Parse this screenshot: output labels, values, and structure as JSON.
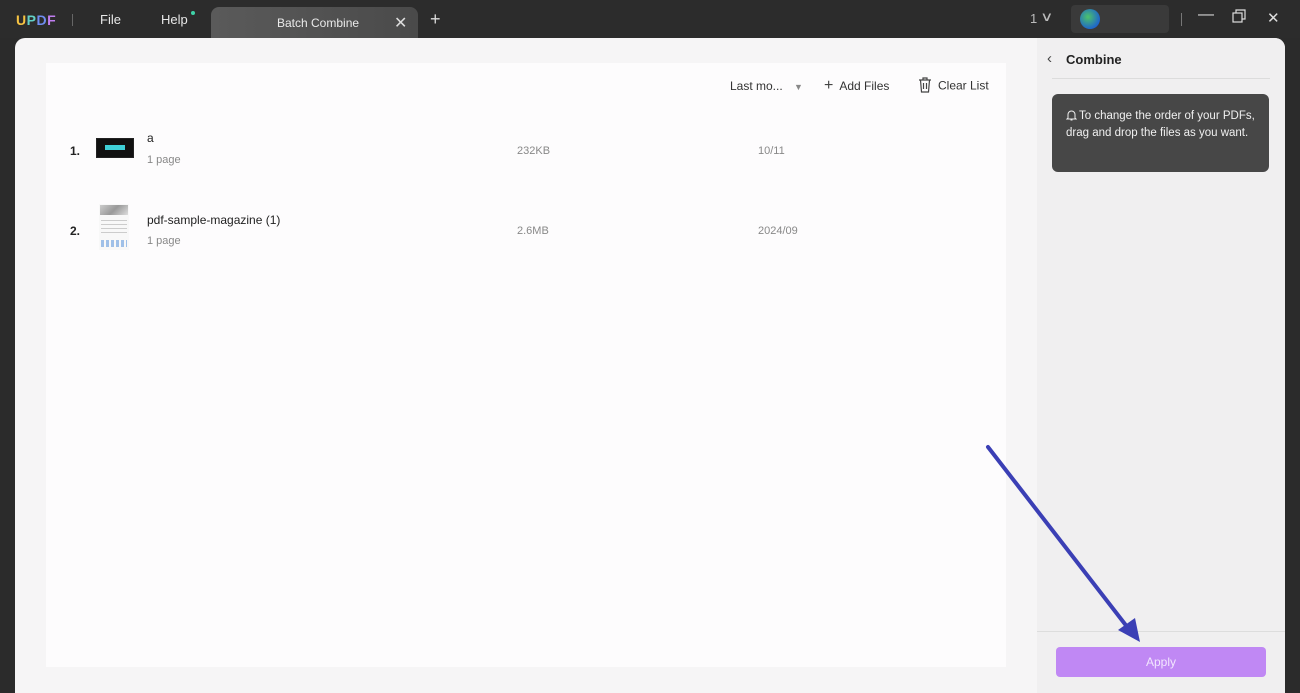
{
  "app": {
    "logo": {
      "u": "U",
      "p": "P",
      "d": "D",
      "f": "F"
    },
    "menu": [
      "File",
      "Help"
    ]
  },
  "tabs": [
    {
      "label": "Batch Combine",
      "active": true
    }
  ],
  "titlebar": {
    "page_count": "1",
    "account_name": ""
  },
  "toolbar": {
    "sort_label": "Last mo...",
    "add_files_label": "Add Files",
    "clear_list_label": "Clear List"
  },
  "files": [
    {
      "index": "1.",
      "name": "a",
      "pages": "1 page",
      "size": "232KB",
      "date": "10/11"
    },
    {
      "index": "2.",
      "name": "pdf-sample-magazine (1)",
      "pages": "1 page",
      "size": "2.6MB",
      "date": "2024/09"
    }
  ],
  "panel": {
    "title": "Combine",
    "tip": "To change the order of your PDFs, drag and drop the files as you want.",
    "apply_label": "Apply"
  },
  "colors": {
    "accent": "#c088f4",
    "annotation_arrow": "#3b3fb5"
  }
}
